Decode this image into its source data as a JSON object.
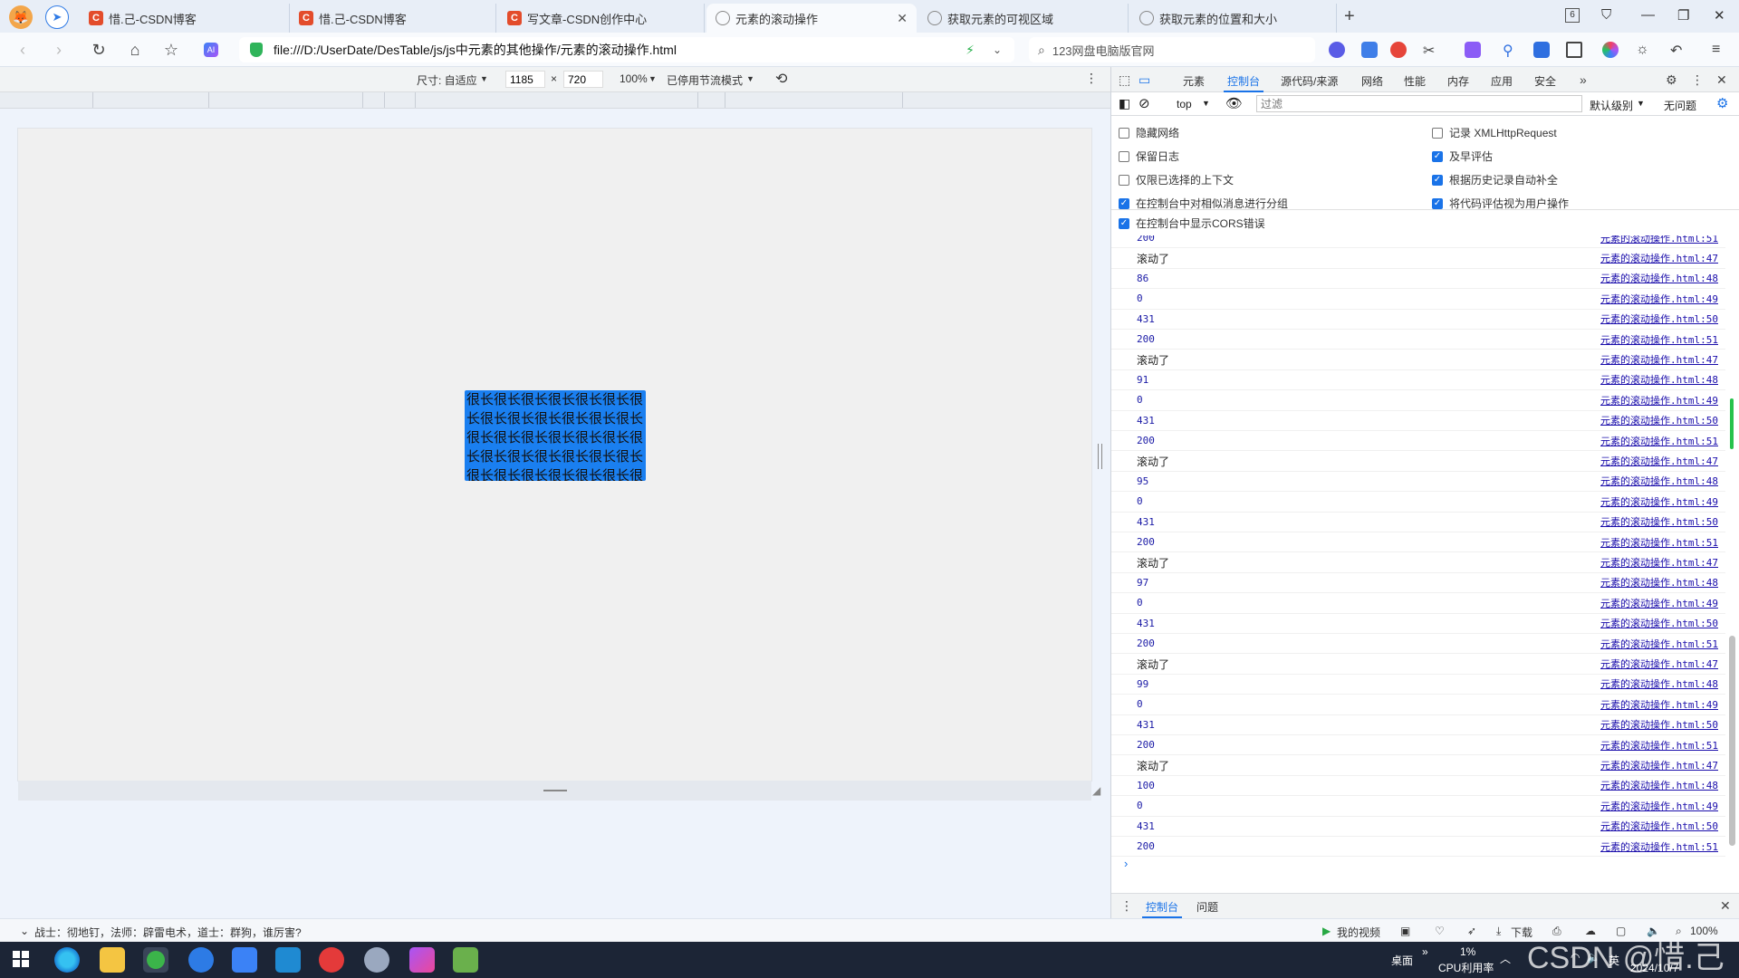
{
  "browser": {
    "tabs": [
      {
        "label": "惜.己-CSDN博客",
        "icon": "csdn-icon",
        "active": false
      },
      {
        "label": "惜.己-CSDN博客",
        "icon": "csdn-icon",
        "active": false
      },
      {
        "label": "写文章-CSDN创作中心",
        "icon": "csdn-icon",
        "active": false
      },
      {
        "label": "元素的滚动操作",
        "icon": "globe-icon",
        "active": true
      },
      {
        "label": "获取元素的可视区域",
        "icon": "globe-icon",
        "active": false
      },
      {
        "label": "获取元素的位置和大小",
        "icon": "globe-icon",
        "active": false
      }
    ],
    "tab_count_badge": "6",
    "url": "file:///D:/UserDate/DesTable/js/js中元素的其他操作/元素的滚动操作.html",
    "search_placeholder": "123网盘电脑版官网"
  },
  "device_toolbar": {
    "dimensions_label": "尺寸: 自适应",
    "width": "1185",
    "times": "×",
    "height": "720",
    "zoom": "100%",
    "throttle": "已停用节流模式"
  },
  "page": {
    "box_text": "很长很长很长很长很长很长很长很长很长很长很长很长很长很长很长很长很长很长很长很长很长很长很长很长很长很长很长很长很长很长很长很长很长很长很长很长很长很长很长很长"
  },
  "devtools": {
    "tabs": [
      "元素",
      "控制台",
      "源代码/来源",
      "网络",
      "性能",
      "内存",
      "应用",
      "安全"
    ],
    "active_tab": "控制台",
    "context": "top",
    "filter_placeholder": "过滤",
    "levels": "默认级别",
    "issues": "无问题",
    "settings_left": [
      {
        "label": "隐藏网络",
        "checked": false
      },
      {
        "label": "保留日志",
        "checked": false
      },
      {
        "label": "仅限已选择的上下文",
        "checked": false
      },
      {
        "label": "在控制台中对相似消息进行分组",
        "checked": true
      },
      {
        "label": "在控制台中显示CORS错误",
        "checked": true
      }
    ],
    "settings_right": [
      {
        "label": "记录 XMLHttpRequest",
        "checked": false
      },
      {
        "label": "及早评估",
        "checked": true
      },
      {
        "label": "根据历史记录自动补全",
        "checked": true
      },
      {
        "label": "将代码评估视为用户操作",
        "checked": true
      }
    ],
    "console_rows": [
      {
        "msg": "200",
        "src": "元素的滚动操作.html:51"
      },
      {
        "msg": "滚动了",
        "src": "元素的滚动操作.html:47"
      },
      {
        "msg": "86",
        "src": "元素的滚动操作.html:48"
      },
      {
        "msg": "0",
        "src": "元素的滚动操作.html:49"
      },
      {
        "msg": "431",
        "src": "元素的滚动操作.html:50"
      },
      {
        "msg": "200",
        "src": "元素的滚动操作.html:51"
      },
      {
        "msg": "滚动了",
        "src": "元素的滚动操作.html:47"
      },
      {
        "msg": "91",
        "src": "元素的滚动操作.html:48"
      },
      {
        "msg": "0",
        "src": "元素的滚动操作.html:49"
      },
      {
        "msg": "431",
        "src": "元素的滚动操作.html:50"
      },
      {
        "msg": "200",
        "src": "元素的滚动操作.html:51"
      },
      {
        "msg": "滚动了",
        "src": "元素的滚动操作.html:47"
      },
      {
        "msg": "95",
        "src": "元素的滚动操作.html:48"
      },
      {
        "msg": "0",
        "src": "元素的滚动操作.html:49"
      },
      {
        "msg": "431",
        "src": "元素的滚动操作.html:50"
      },
      {
        "msg": "200",
        "src": "元素的滚动操作.html:51"
      },
      {
        "msg": "滚动了",
        "src": "元素的滚动操作.html:47"
      },
      {
        "msg": "97",
        "src": "元素的滚动操作.html:48"
      },
      {
        "msg": "0",
        "src": "元素的滚动操作.html:49"
      },
      {
        "msg": "431",
        "src": "元素的滚动操作.html:50"
      },
      {
        "msg": "200",
        "src": "元素的滚动操作.html:51"
      },
      {
        "msg": "滚动了",
        "src": "元素的滚动操作.html:47"
      },
      {
        "msg": "99",
        "src": "元素的滚动操作.html:48"
      },
      {
        "msg": "0",
        "src": "元素的滚动操作.html:49"
      },
      {
        "msg": "431",
        "src": "元素的滚动操作.html:50"
      },
      {
        "msg": "200",
        "src": "元素的滚动操作.html:51"
      },
      {
        "msg": "滚动了",
        "src": "元素的滚动操作.html:47"
      },
      {
        "msg": "100",
        "src": "元素的滚动操作.html:48"
      },
      {
        "msg": "0",
        "src": "元素的滚动操作.html:49"
      },
      {
        "msg": "431",
        "src": "元素的滚动操作.html:50"
      },
      {
        "msg": "200",
        "src": "元素的滚动操作.html:51"
      }
    ],
    "drawer_tabs": [
      "控制台",
      "问题"
    ]
  },
  "status_bar": {
    "news_text": "战士：彻地钉，法师：辟雷电术，道士：群狗，谁厉害?",
    "my_video": "我的视频",
    "download": "下载",
    "zoom": "100%"
  },
  "taskbar": {
    "desktop_label": "桌面",
    "cpu_percent": "1%",
    "cpu_label": "CPU利用率",
    "ime": "英",
    "date": "2024/10/7",
    "watermark": "CSDN @惜.己"
  }
}
